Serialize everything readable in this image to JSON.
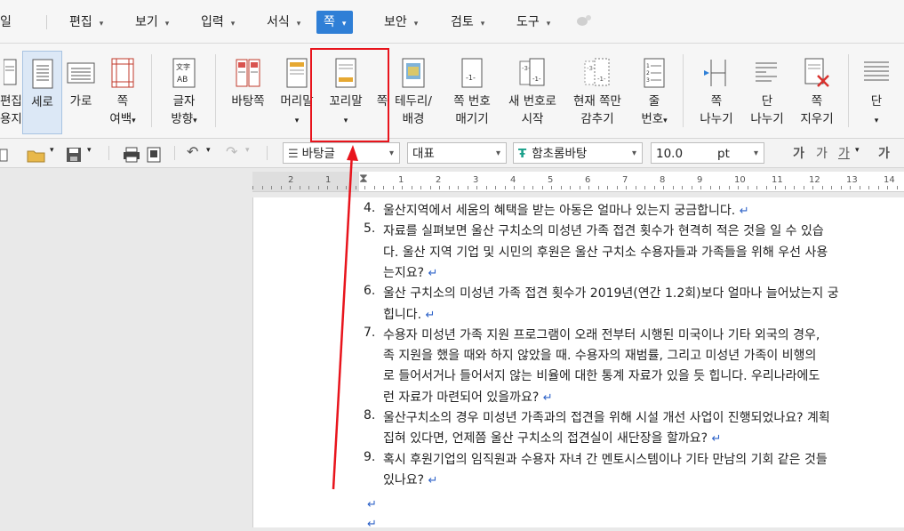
{
  "menu": {
    "partial_left": "일",
    "items": [
      {
        "label": "편집"
      },
      {
        "label": "보기"
      },
      {
        "label": "입력"
      },
      {
        "label": "서식"
      },
      {
        "label": "쪽",
        "active": true
      },
      {
        "label": "보안"
      },
      {
        "label": "검토"
      },
      {
        "label": "도구"
      }
    ]
  },
  "ribbon": {
    "partial_left_1": "편집",
    "partial_left_2": "용지",
    "buttons": [
      {
        "id": "vertical",
        "line1": "세로",
        "line2": ""
      },
      {
        "id": "horizontal",
        "line1": "가로",
        "line2": ""
      },
      {
        "id": "page-margin",
        "line1": "쪽",
        "line2": "여백"
      },
      {
        "id": "text-direction",
        "line1": "글자",
        "line2": "방향"
      },
      {
        "id": "background",
        "line1": "바탕쪽",
        "line2": ""
      },
      {
        "id": "header",
        "line1": "머리말",
        "line2": ""
      },
      {
        "id": "footer",
        "line1": "꼬리말",
        "line2": ""
      },
      {
        "id": "page-border-partial",
        "line1": "쪽",
        "line2": ""
      },
      {
        "id": "border-background",
        "line1": "테두리/",
        "line2": "배경"
      },
      {
        "id": "page-numbering",
        "line1": "쪽 번호",
        "line2": "매기기"
      },
      {
        "id": "new-number",
        "line1": "새 번호로",
        "line2": "시작"
      },
      {
        "id": "hide-current",
        "line1": "현재 쪽만",
        "line2": "감추기"
      },
      {
        "id": "line-number",
        "line1": "줄",
        "line2": "번호"
      },
      {
        "id": "page-break",
        "line1": "쪽",
        "line2": "나누기"
      },
      {
        "id": "column-break",
        "line1": "단",
        "line2": "나누기"
      },
      {
        "id": "page-delete",
        "line1": "쪽",
        "line2": "지우기"
      },
      {
        "id": "column",
        "line1": "단",
        "line2": ""
      }
    ]
  },
  "toolbar": {
    "style": "바탕글",
    "lang": "대표",
    "font": "함초롬바탕",
    "font_icon": "Ŧ",
    "size": "10.0",
    "unit": "pt",
    "fmt1": "가",
    "fmt2": "가",
    "fmt3": "가",
    "fmt4": "가"
  },
  "ruler": {
    "labels": [
      "2",
      "1",
      "1",
      "2",
      "3",
      "4",
      "5",
      "6",
      "7",
      "8",
      "9",
      "10",
      "11",
      "12",
      "13",
      "14"
    ]
  },
  "document": {
    "lines": [
      {
        "num": "4.",
        "text": "울산지역에서 세움의 혜택을 받는 아동은 얼마나 있는지 궁금합니다. "
      },
      {
        "num": "5.",
        "text": "자료를 실펴보면 울산 구치소의 미성년 가족 접견 횟수가 현격히 적은 것을 일 수 있습"
      },
      {
        "num": "",
        "text": "다. 울산 지역 기업 및 시민의 후원은 울산 구치소 수용자들과 가족들을 위해 우선 사용"
      },
      {
        "num": "",
        "text": "는지요? "
      },
      {
        "num": "6.",
        "text": "울산 구치소의 미성년 가족 접견 횟수가 2019년(연간 1.2회)보다 얼마나 늘어났는지 궁"
      },
      {
        "num": "",
        "text": "힙니다. "
      },
      {
        "num": "7.",
        "text": "수용자 미성년 가족 지원 프로그램이 오래 전부터 시행된 미국이나 기타 외국의 경우,"
      },
      {
        "num": "",
        "text": "족 지원을 했을 때와 하지 않았을 때. 수용자의 재범률, 그리고 미성년 가족이 비행의"
      },
      {
        "num": "",
        "text": "로 들어서거나 들어서지 않는 비율에 대한 통계 자료가 있을 듯 힙니다. 우리나라에도"
      },
      {
        "num": "",
        "text": "런 자료가 마련되어 있을까요? "
      },
      {
        "num": "8.",
        "text": "울산구치소의 경우 미성년 가족과의 접견을 위해 시설 개선 사업이 진행되었나요? 계획"
      },
      {
        "num": "",
        "text": "집혀 있다면, 언제쯤 울산 구치소의 접견실이 새단장을 할까요? "
      },
      {
        "num": "9.",
        "text": "혹시 후원기업의 임직원과 수용자 자녀 간 멘토시스템이나 기타 만남의 기회 같은 것들"
      },
      {
        "num": "",
        "text": "있나요? "
      }
    ],
    "return_mark": "↵"
  }
}
